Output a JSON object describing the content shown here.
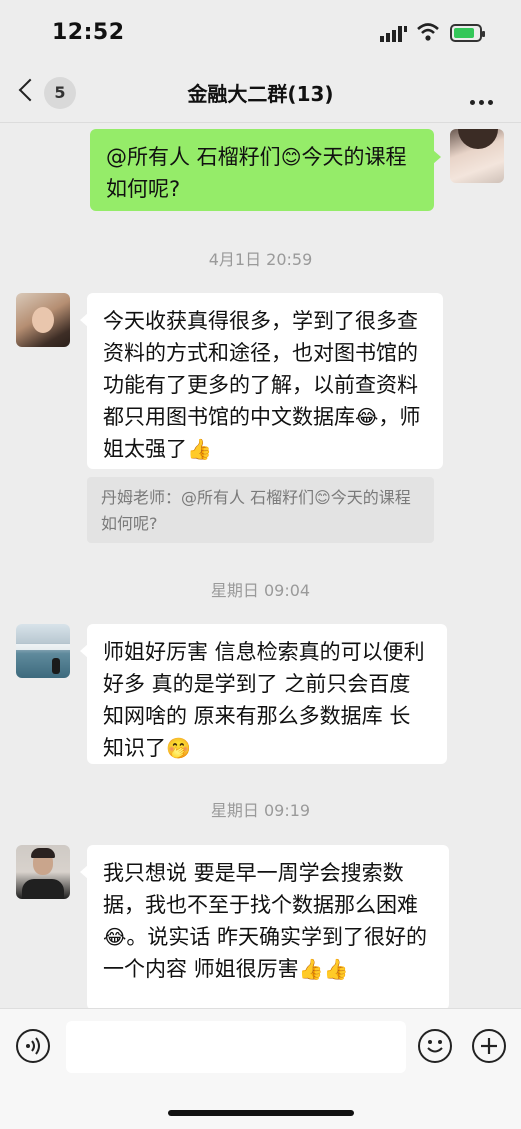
{
  "status_bar": {
    "time": "12:52"
  },
  "nav": {
    "back_badge": "5",
    "title": "金融大二群(13)"
  },
  "messages": {
    "m1": {
      "part1": "@所有人 石榴籽们",
      "emoji": "😊",
      "part2": "今天的课程如何呢?"
    },
    "ts1": "4月1日 20:59",
    "m2": {
      "text": "今天收获真得很多，学到了很多查资料的方式和途径，也对图书馆的功能有了更多的了解，以前查资料都只用图书馆的中文数据库",
      "emoji1": "😂",
      "text2": "，师姐太强了",
      "emoji2": "👍"
    },
    "quote": {
      "part1": "丹姆老师：@所有人 石榴籽们",
      "emoji": "😊",
      "part2": "今天的课程如何呢?"
    },
    "ts2": "星期日 09:04",
    "m3": {
      "text": "师姐好厉害  信息检索真的可以便利好多  真的是学到了  之前只会百度  知网啥的  原来有那么多数据库  长知识了",
      "emoji": "🤭"
    },
    "ts3": "星期日 09:19",
    "m4": {
      "text": "我只想说 要是早一周学会搜索数据，我也不至于找个数据那么困难",
      "emoji1": "😂",
      "text2": "。说实话 昨天确实学到了很好的一个内容 师姐很厉害",
      "emoji2": "👍",
      "emoji3": "👍"
    }
  },
  "input": {
    "placeholder": ""
  },
  "icons": {
    "voice": "voice-icon",
    "emoji": "emoji-icon",
    "add": "add-icon"
  },
  "colors": {
    "my_bubble": "#95ec69",
    "other_bubble": "#ffffff",
    "background": "#ededed"
  }
}
